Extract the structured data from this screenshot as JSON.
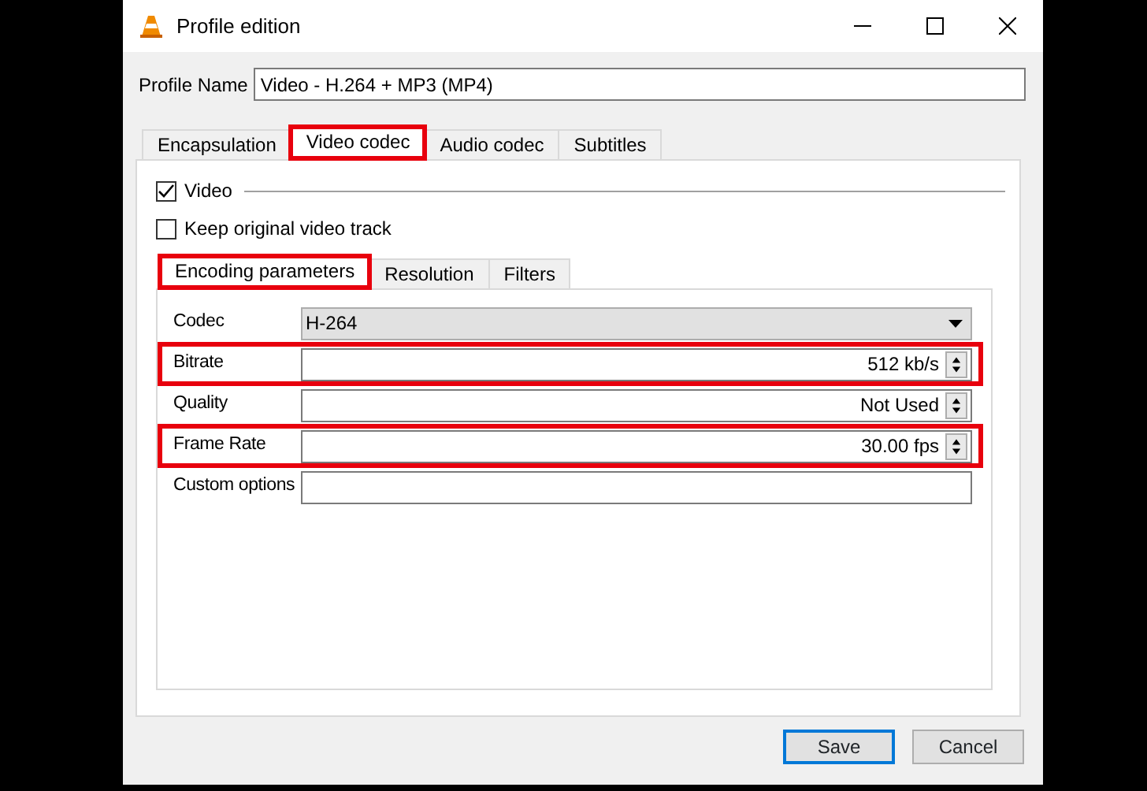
{
  "window": {
    "title": "Profile edition"
  },
  "profile_name": {
    "label": "Profile Name",
    "value": "Video - H.264 + MP3 (MP4)"
  },
  "tabs": [
    {
      "label": "Encapsulation",
      "selected": false,
      "highlighted": false
    },
    {
      "label": "Video codec",
      "selected": true,
      "highlighted": true
    },
    {
      "label": "Audio codec",
      "selected": false,
      "highlighted": false
    },
    {
      "label": "Subtitles",
      "selected": false,
      "highlighted": false
    }
  ],
  "video_group": {
    "label": "Video",
    "checked": true
  },
  "keep_original": {
    "label": "Keep original video track",
    "checked": false
  },
  "sub_tabs": [
    {
      "label": "Encoding parameters",
      "selected": true,
      "highlighted": true
    },
    {
      "label": "Resolution",
      "selected": false,
      "highlighted": false
    },
    {
      "label": "Filters",
      "selected": false,
      "highlighted": false
    }
  ],
  "fields": [
    {
      "kind": "dropdown",
      "label": "Codec",
      "value": "H-264",
      "highlighted": false
    },
    {
      "kind": "spinner",
      "label": "Bitrate",
      "value": "512 kb/s",
      "highlighted": true
    },
    {
      "kind": "spinner",
      "label": "Quality",
      "value": "Not Used",
      "highlighted": false
    },
    {
      "kind": "spinner",
      "label": "Frame Rate",
      "value": "30.00 fps",
      "highlighted": true
    },
    {
      "kind": "text",
      "label": "Custom options",
      "highlighted": false
    }
  ],
  "buttons": [
    {
      "label": "Save",
      "default": true
    },
    {
      "label": "Cancel",
      "default": false
    }
  ]
}
